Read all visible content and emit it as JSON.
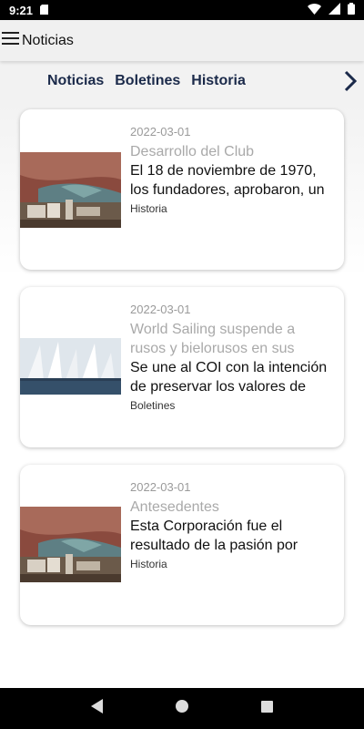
{
  "status": {
    "time": "9:21"
  },
  "appbar": {
    "title": "Noticias"
  },
  "tabs": [
    {
      "label": "Noticias"
    },
    {
      "label": "Boletines"
    },
    {
      "label": "Historia"
    }
  ],
  "cards": [
    {
      "date": "2022-03-01",
      "title": "Desarrollo del Club",
      "excerpt_lines": [
        "El 18 de noviembre de 1970,",
        "los fundadores, aprobaron, un"
      ],
      "category": "Historia",
      "image": "landscape-harbor"
    },
    {
      "date": "2022-03-01",
      "title_lines": [
        "World Sailing suspende a",
        "rusos y bielorusos en sus"
      ],
      "excerpt_lines": [
        "Se une al COI con la intención",
        "de preservar los valores de"
      ],
      "category": "Boletines",
      "image": "sailboats"
    },
    {
      "date": "2022-03-01",
      "title": "Antesedentes",
      "excerpt_lines": [
        "Esta Corporación fue el",
        "resultado de la pasión por"
      ],
      "category": "Historia",
      "image": "landscape-harbor"
    }
  ],
  "colors": {
    "tab_text": "#1b2a4a",
    "muted": "#a9a9a9",
    "navbar": "#000000"
  }
}
